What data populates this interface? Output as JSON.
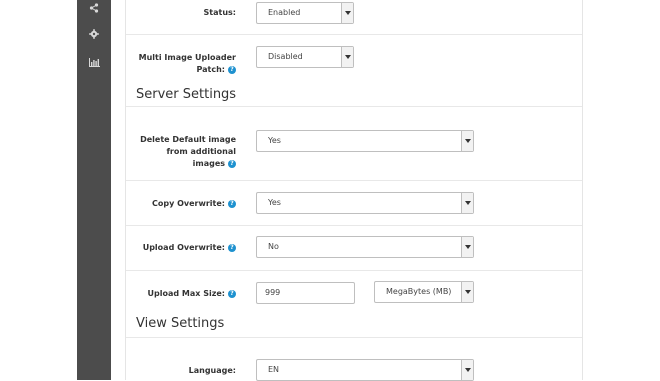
{
  "sidebar": {
    "icons": [
      "share-icon",
      "gear-icon",
      "bar-chart-icon"
    ]
  },
  "fields": {
    "status": {
      "label": "Status:",
      "value": "Enabled"
    },
    "multi_image": {
      "label_line1": "Multi Image Uploader",
      "label_line2": "Patch:",
      "value": "Disabled"
    }
  },
  "sections": {
    "server": "Server Settings",
    "view": "View Settings"
  },
  "server_settings": {
    "delete_default": {
      "label_line1": "Delete Default image",
      "label_line2": "from additional",
      "label_line3": "images",
      "value": "Yes"
    },
    "copy_overwrite": {
      "label": "Copy Overwrite:",
      "value": "Yes"
    },
    "upload_overwrite": {
      "label": "Upload Overwrite:",
      "value": "No"
    },
    "upload_max_size": {
      "label": "Upload Max Size:",
      "value": "999",
      "unit": "MegaBytes (MB)"
    }
  },
  "view_settings": {
    "language": {
      "label": "Language:",
      "value": "EN"
    }
  },
  "help_glyph": "?"
}
